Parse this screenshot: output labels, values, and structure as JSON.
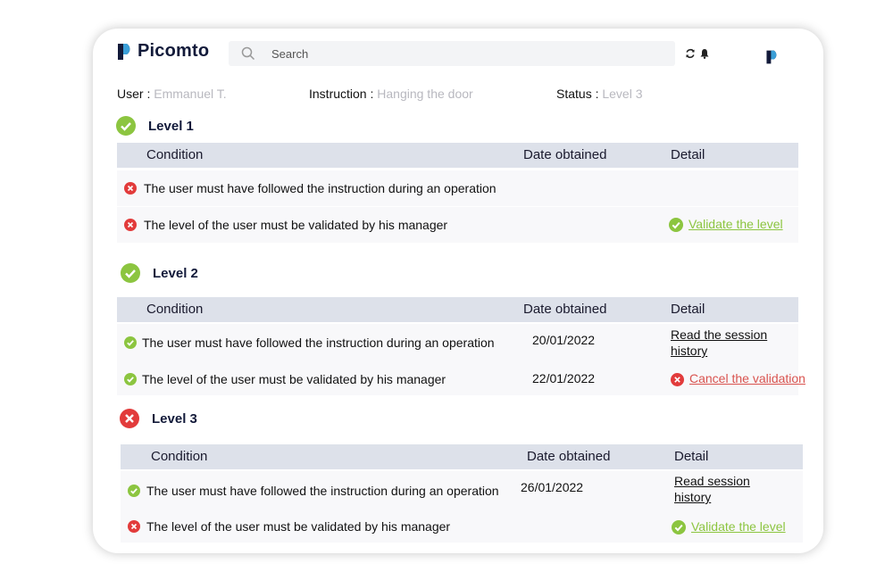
{
  "app": {
    "logo_text": "Picomto"
  },
  "search": {
    "placeholder": "Search"
  },
  "meta": {
    "user_label": "User :",
    "user_value": "Emmanuel T.",
    "instruction_label": "Instruction :",
    "instruction_value": "Hanging the door",
    "status_label": "Status :",
    "status_value": "Level 3"
  },
  "table_headers": {
    "condition": "Condition",
    "date": "Date obtained",
    "detail": "Detail"
  },
  "levels": [
    {
      "name": "Level 1",
      "status": "passed",
      "rows": [
        {
          "text": "The user must have followed the instruction during an operation",
          "status": "failed",
          "date": "",
          "detail": ""
        },
        {
          "text": "The level of the user must be validated by his manager",
          "status": "failed",
          "date": "",
          "detail": "Validate the level"
        }
      ]
    },
    {
      "name": "Level 2",
      "status": "passed",
      "rows": [
        {
          "text": "The user must have followed the instruction during an operation",
          "status": "passed",
          "date": "20/01/2022",
          "detail_line1": "Read the session",
          "detail_line2": "history"
        },
        {
          "text": "The level of the user must be validated by his manager",
          "status": "passed",
          "date": "22/01/2022",
          "detail": "Cancel the validation"
        }
      ]
    },
    {
      "name": "Level 3",
      "status": "failed",
      "rows": [
        {
          "text": "The user must have followed the instruction during an operation",
          "status": "passed",
          "date": "26/01/2022",
          "detail_line1": "Read session",
          "detail_line2": "history"
        },
        {
          "text": "The level of the user must be validated by his manager",
          "status": "failed",
          "date": "",
          "detail": "Validate the level"
        }
      ]
    }
  ],
  "colors": {
    "success": "#8cc540",
    "error": "#e23b3b",
    "header_bg": "#dde1ea",
    "brand": "#3a9fd8"
  }
}
